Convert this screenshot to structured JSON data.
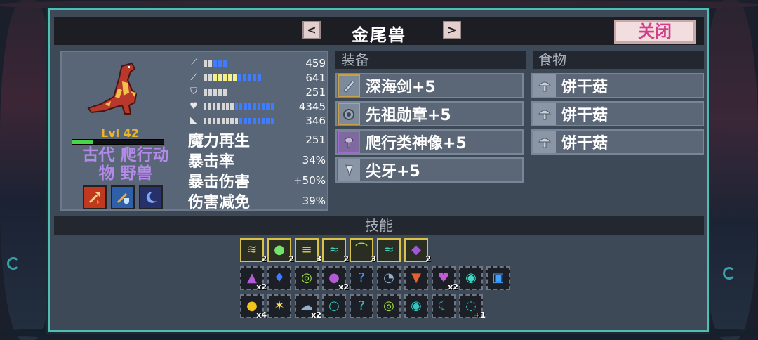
{
  "window": {
    "title": "金尾兽",
    "prev_label": "<",
    "next_label": ">",
    "close_label": "关闭"
  },
  "character": {
    "level": "Lvl 42",
    "hp_fraction": 0.22,
    "name_line1": "古代 爬行动",
    "name_line2": "物 野兽",
    "stats": [
      {
        "icon": "sword-icon",
        "value": "459"
      },
      {
        "icon": "wand-icon",
        "value": "641"
      },
      {
        "icon": "shield-icon",
        "value": "251"
      },
      {
        "icon": "heart-icon",
        "value": "4345"
      },
      {
        "icon": "boot-icon",
        "value": "346"
      }
    ],
    "extra_stats": [
      {
        "label": "魔力再生",
        "value": "251"
      },
      {
        "label": "暴击率",
        "value": "34%"
      },
      {
        "label": "暴击伤害",
        "value": "+50%"
      },
      {
        "label": "伤害减免",
        "value": "39%"
      }
    ],
    "traits": [
      {
        "icon": "fire-arrow-icon",
        "color": "#c0391f"
      },
      {
        "icon": "staff-shield-icon",
        "color": "#2f5fa8"
      },
      {
        "icon": "moon-icon",
        "color": "#28306a"
      }
    ]
  },
  "equipment": {
    "header": "装备",
    "items": [
      {
        "label": "深海剑+5",
        "icon": "sword-icon",
        "rarity": "gold"
      },
      {
        "label": "先祖勋章+5",
        "icon": "medal-icon",
        "rarity": "gold"
      },
      {
        "label": "爬行类神像+5",
        "icon": "idol-icon",
        "rarity": "purple"
      },
      {
        "label": "尖牙+5",
        "icon": "fang-icon",
        "rarity": "plain"
      }
    ]
  },
  "food": {
    "header": "食物",
    "items": [
      {
        "label": "饼干菇",
        "icon": "mushroom-icon"
      },
      {
        "label": "饼干菇",
        "icon": "mushroom-icon"
      },
      {
        "label": "饼干菇",
        "icon": "mushroom-icon"
      }
    ]
  },
  "skills": {
    "header": "技能",
    "rows": [
      [
        {
          "icon": "tornado-icon",
          "count": "2",
          "color": "#d8c24a"
        },
        {
          "icon": "orb-icon",
          "count": "2",
          "color": "#74e36a"
        },
        {
          "icon": "wind-icon",
          "count": "3",
          "color": "#d8c24a"
        },
        {
          "icon": "wave-icon",
          "count": "2",
          "color": "#3fd6c4"
        },
        {
          "icon": "arc-icon",
          "count": "3",
          "color": "#a6e24a"
        },
        {
          "icon": "stream-icon",
          "count": "",
          "color": "#3fd6c4"
        },
        {
          "icon": "rune-shield-icon",
          "count": "2",
          "color": "#9b59d6"
        }
      ],
      [
        {
          "icon": "potion-up-icon",
          "count": "x2",
          "color": "#b45ad6"
        },
        {
          "icon": "drops-icon",
          "count": "",
          "color": "#3f7cff"
        },
        {
          "icon": "crown-ring-icon",
          "count": "",
          "color": "#a6e24a"
        },
        {
          "icon": "orb-up-icon",
          "count": "x2",
          "color": "#b45ad6"
        },
        {
          "icon": "mystery-icon",
          "count": "",
          "color": "#3f9cff"
        },
        {
          "icon": "dash-clock-icon",
          "count": "",
          "color": "#8fb0d0"
        },
        {
          "icon": "fire-down-icon",
          "count": "",
          "color": "#e5602e"
        },
        {
          "icon": "heart-up-icon",
          "count": "x2",
          "color": "#c25ad6"
        },
        {
          "icon": "ripple-icon",
          "count": "",
          "color": "#3fd6c4"
        },
        {
          "icon": "shield-box-icon",
          "count": "",
          "color": "#3fa0ff"
        }
      ],
      [
        {
          "icon": "sun-orb-icon",
          "count": "x4",
          "color": "#f2c31a"
        },
        {
          "icon": "starburst-icon",
          "count": "",
          "color": "#ffe066"
        },
        {
          "icon": "cloud-icon",
          "count": "x2",
          "color": "#8fb0d0"
        },
        {
          "icon": "ring-icon",
          "count": "",
          "color": "#2fc7c0"
        },
        {
          "icon": "mystery-icon",
          "count": "",
          "color": "#2fc7c0"
        },
        {
          "icon": "green-ring-icon",
          "count": "",
          "color": "#a6e24a"
        },
        {
          "icon": "shield-ring-icon",
          "count": "",
          "color": "#2fc7c0"
        },
        {
          "icon": "crescent-icon",
          "count": "",
          "color": "#2fc7c0"
        },
        {
          "icon": "plus-one-icon",
          "count": "+1",
          "color": "#2fc7c0"
        }
      ]
    ]
  }
}
